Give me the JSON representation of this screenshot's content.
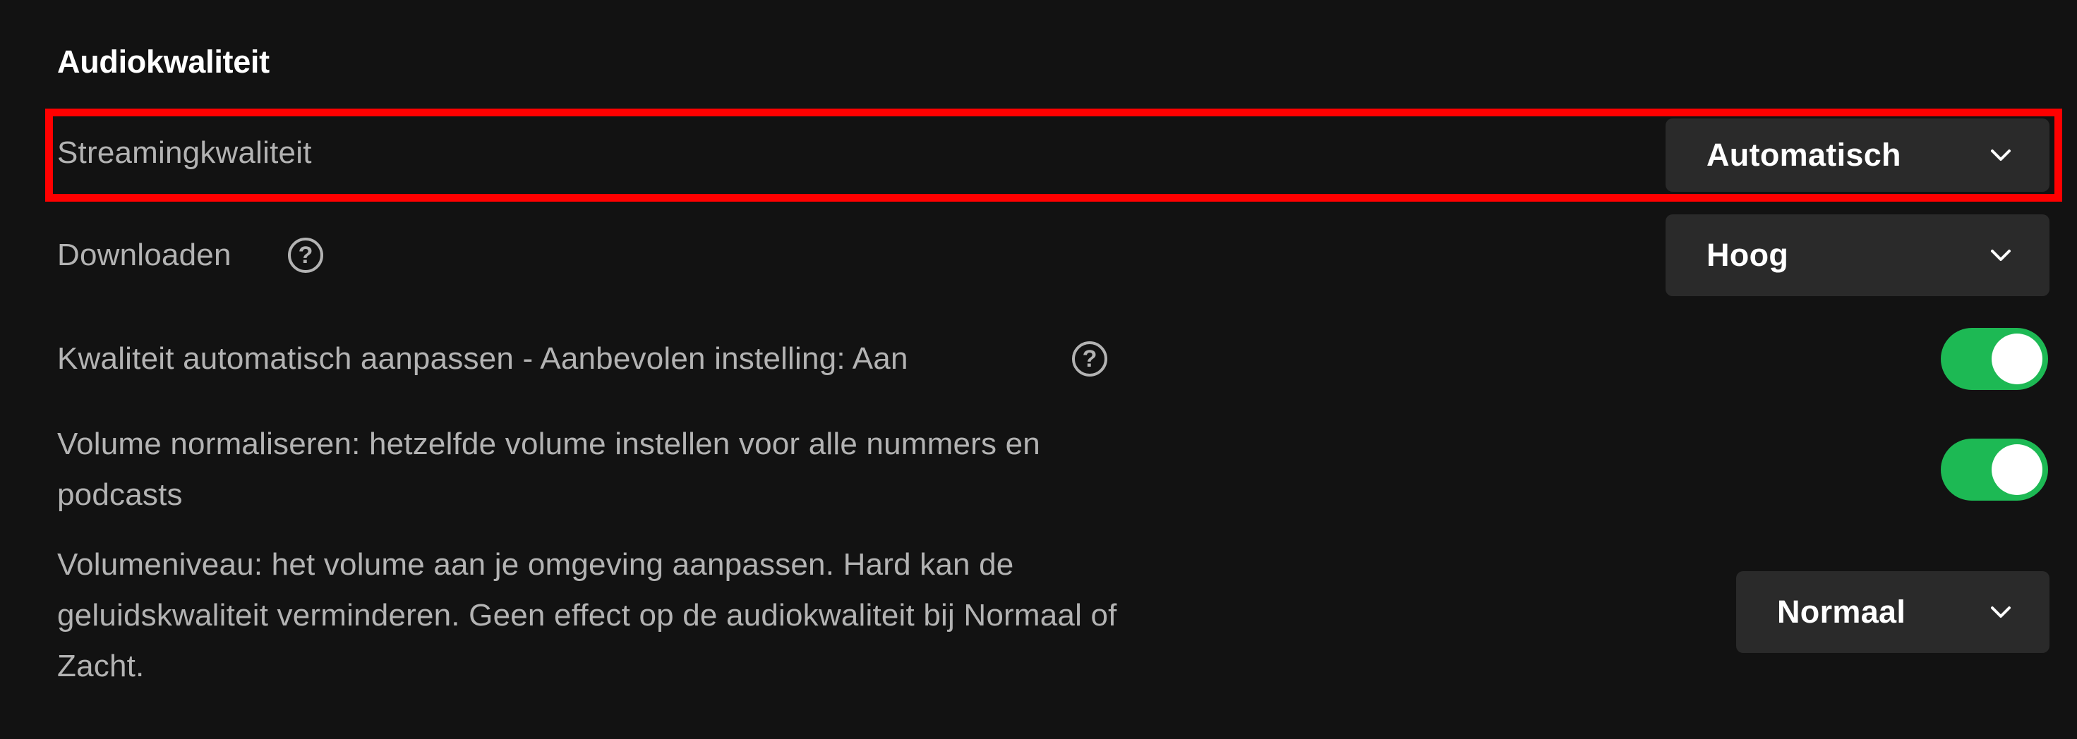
{
  "section": {
    "title": "Audiokwaliteit"
  },
  "rows": {
    "streaming": {
      "label": "Streamingkwaliteit",
      "value": "Automatisch"
    },
    "download": {
      "label": "Downloaden",
      "value": "Hoog",
      "help_glyph": "?"
    },
    "auto_adjust": {
      "label": "Kwaliteit automatisch aanpassen - Aanbevolen instelling: Aan",
      "help_glyph": "?",
      "enabled": true
    },
    "normalize": {
      "label_line1": "Volume normaliseren: hetzelfde volume instellen voor alle nummers en",
      "label_line2": "podcasts",
      "enabled": true
    },
    "volume_level": {
      "label_line1": "Volumeniveau: het volume aan je omgeving aanpassen. Hard kan de",
      "label_line2": "geluidskwaliteit verminderen. Geen effect op de audiokwaliteit bij Normaal of",
      "label_line3": "Zacht.",
      "value": "Normaal"
    }
  },
  "colors": {
    "background": "#121212",
    "text_secondary": "#b3b3b3",
    "text_primary": "#ffffff",
    "dropdown_bg": "#2a2a2a",
    "toggle_on": "#1db954",
    "highlight": "#ff0000"
  },
  "icons": {
    "dropdown": "chevron-down-icon",
    "help": "question-circle-icon"
  }
}
